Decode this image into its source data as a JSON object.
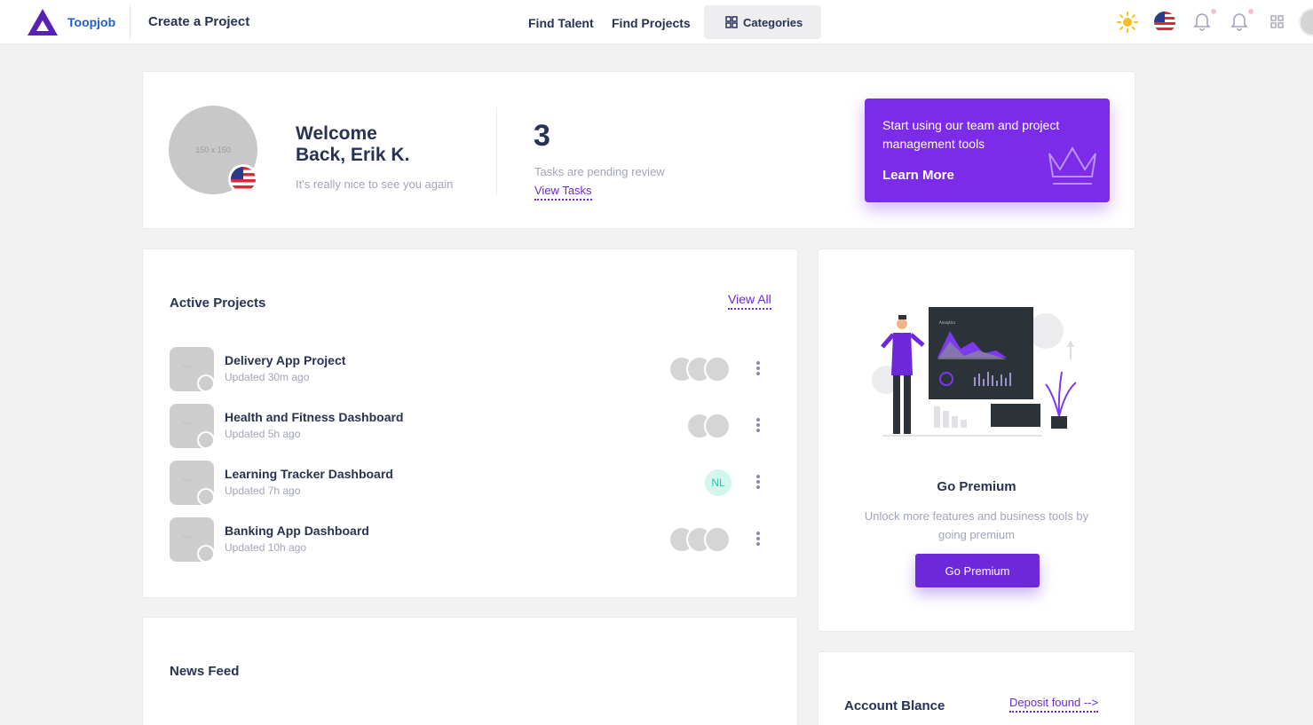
{
  "navbar": {
    "brand": "Toopjob",
    "create_project": "Create a Project",
    "find_talent": "Find Talent",
    "find_projects": "Find Projects",
    "categories": "Categories"
  },
  "welcome": {
    "avatar_placeholder": "150 x 150",
    "title": "Welcome\nBack, Erik K.",
    "subtitle": "It's really nice to see you again",
    "pending_count": "3",
    "pending_label": "Tasks are pending review",
    "view_tasks": "View Tasks"
  },
  "promo": {
    "text": "Start using our team and project management tools",
    "link": "Learn More"
  },
  "active_projects": {
    "title": "Active Projects",
    "view_all": "View All",
    "items": [
      {
        "name": "Delivery App Project",
        "updated": "Updated 30m ago",
        "members": 3
      },
      {
        "name": "Health and Fitness Dashboard",
        "updated": "Updated 5h ago",
        "members": 2
      },
      {
        "name": "Learning Tracker Dashboard",
        "updated": "Updated 7h ago",
        "initials": "NL"
      },
      {
        "name": "Banking App Dashboard",
        "updated": "Updated 10h ago",
        "members": 3
      }
    ]
  },
  "premium": {
    "title": "Go Premium",
    "text": "Unlock more features and business tools by going premium",
    "button": "Go Premium"
  },
  "news_feed": {
    "title": "News Feed"
  },
  "account": {
    "title": "Account Blance",
    "deposit": "Deposit found -->"
  },
  "colors": {
    "primary": "#6d28d9",
    "promo": "#7c2be8",
    "brand": "#1f5fcc"
  }
}
